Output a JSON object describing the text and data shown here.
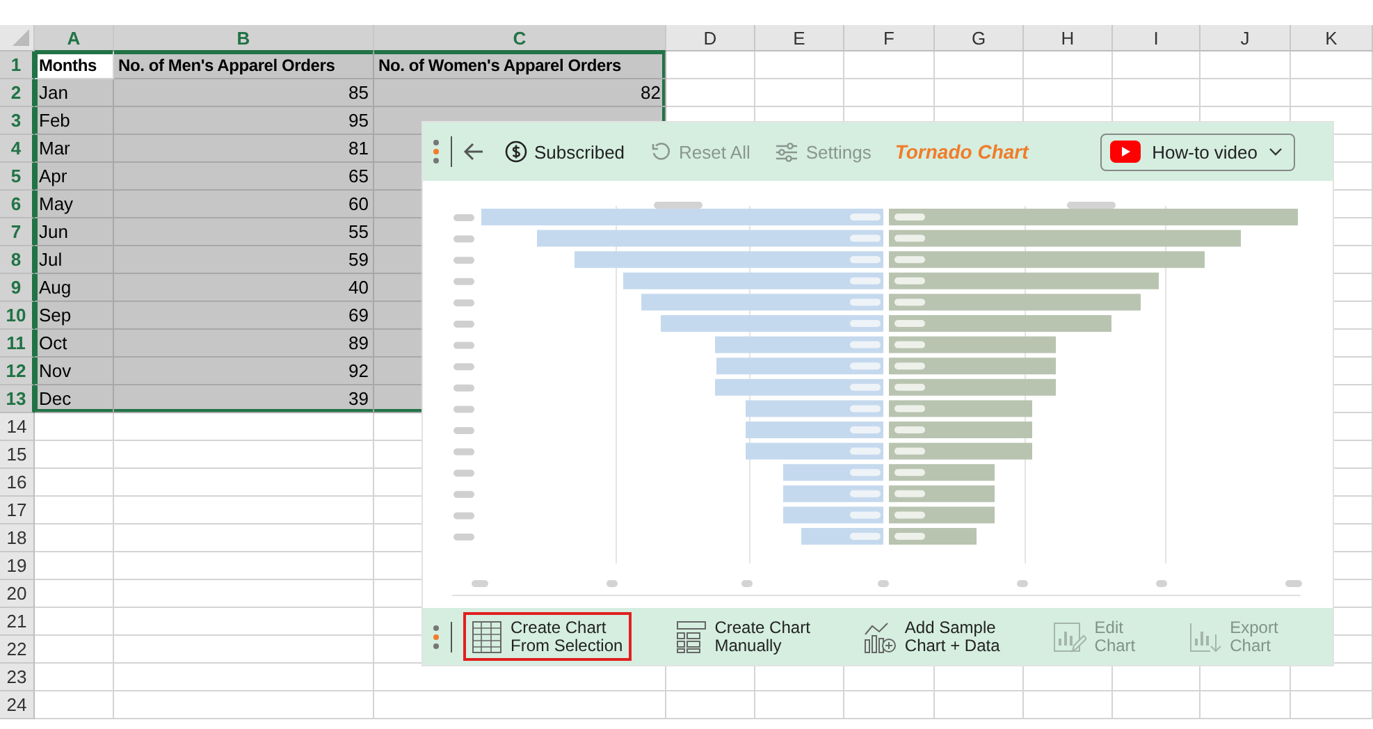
{
  "sheet": {
    "columns": [
      {
        "label": "A",
        "selected": true
      },
      {
        "label": "B",
        "selected": true
      },
      {
        "label": "C",
        "selected": true
      },
      {
        "label": "D",
        "selected": false
      },
      {
        "label": "E",
        "selected": false
      },
      {
        "label": "F",
        "selected": false
      },
      {
        "label": "G",
        "selected": false
      },
      {
        "label": "H",
        "selected": false
      },
      {
        "label": "I",
        "selected": false
      },
      {
        "label": "J",
        "selected": false
      },
      {
        "label": "K",
        "selected": false
      }
    ],
    "rows": [
      {
        "number": "1",
        "selected": true,
        "kind": "header",
        "cells": [
          "Months",
          "No. of Men's Apparel Orders",
          "No. of Women's Apparel Orders"
        ]
      },
      {
        "number": "2",
        "selected": true,
        "kind": "data",
        "cells": [
          "Jan",
          "85",
          "82"
        ]
      },
      {
        "number": "3",
        "selected": true,
        "kind": "data",
        "cells": [
          "Feb",
          "95"
        ]
      },
      {
        "number": "4",
        "selected": true,
        "kind": "data",
        "cells": [
          "Mar",
          "81"
        ]
      },
      {
        "number": "5",
        "selected": true,
        "kind": "data",
        "cells": [
          "Apr",
          "65"
        ]
      },
      {
        "number": "6",
        "selected": true,
        "kind": "data",
        "cells": [
          "May",
          "60"
        ]
      },
      {
        "number": "7",
        "selected": true,
        "kind": "data",
        "cells": [
          "Jun",
          "55"
        ]
      },
      {
        "number": "8",
        "selected": true,
        "kind": "data",
        "cells": [
          "Jul",
          "59"
        ]
      },
      {
        "number": "9",
        "selected": true,
        "kind": "data",
        "cells": [
          "Aug",
          "40"
        ]
      },
      {
        "number": "10",
        "selected": true,
        "kind": "data",
        "cells": [
          "Sep",
          "69"
        ]
      },
      {
        "number": "11",
        "selected": true,
        "kind": "data",
        "cells": [
          "Oct",
          "89"
        ]
      },
      {
        "number": "12",
        "selected": true,
        "kind": "data",
        "cells": [
          "Nov",
          "92"
        ]
      },
      {
        "number": "13",
        "selected": true,
        "kind": "data",
        "cells": [
          "Dec",
          "39"
        ]
      },
      {
        "number": "14",
        "selected": false,
        "kind": "empty"
      },
      {
        "number": "15",
        "selected": false,
        "kind": "empty"
      },
      {
        "number": "16",
        "selected": false,
        "kind": "empty"
      },
      {
        "number": "17",
        "selected": false,
        "kind": "empty"
      },
      {
        "number": "18",
        "selected": false,
        "kind": "empty"
      },
      {
        "number": "19",
        "selected": false,
        "kind": "empty"
      },
      {
        "number": "20",
        "selected": false,
        "kind": "empty"
      },
      {
        "number": "21",
        "selected": false,
        "kind": "empty"
      },
      {
        "number": "22",
        "selected": false,
        "kind": "empty"
      },
      {
        "number": "23",
        "selected": false,
        "kind": "empty"
      },
      {
        "number": "24",
        "selected": false,
        "kind": "empty"
      }
    ]
  },
  "add_in": {
    "toolbar": {
      "items": [
        {
          "kind": "subscription",
          "label": "Subscribed",
          "disabled": false
        },
        {
          "kind": "reset",
          "label": "Reset All",
          "disabled": true
        },
        {
          "kind": "settings",
          "label": "Settings",
          "disabled": true
        }
      ],
      "title": "Tornado Chart",
      "video_button": {
        "label": "How-to video"
      }
    },
    "actions": [
      {
        "kind": "from-selection",
        "lines": [
          "Create Chart",
          "From Selection"
        ],
        "selected": true,
        "disabled": false
      },
      {
        "kind": "manual",
        "lines": [
          "Create Chart",
          "Manually"
        ],
        "selected": false,
        "disabled": false
      },
      {
        "kind": "sample",
        "lines": [
          "Add Sample",
          "Chart + Data"
        ],
        "selected": false,
        "disabled": false
      },
      {
        "kind": "edit",
        "lines": [
          "Edit",
          "Chart"
        ],
        "selected": false,
        "disabled": true
      },
      {
        "kind": "export",
        "lines": [
          "Export",
          "Chart"
        ],
        "selected": false,
        "disabled": true
      }
    ]
  }
}
